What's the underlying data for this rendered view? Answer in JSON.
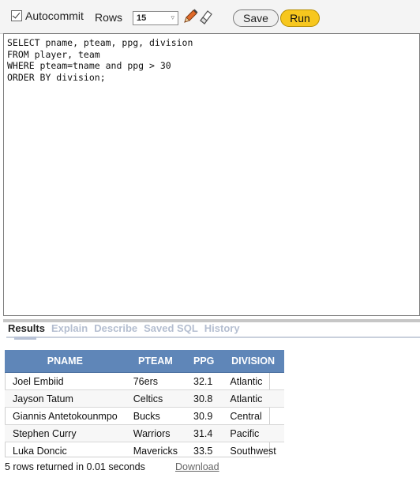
{
  "toolbar": {
    "autocommit_label": "Autocommit",
    "rows_label": "Rows",
    "rows_value": "15",
    "save_label": "Save",
    "run_label": "Run"
  },
  "editor": {
    "sql": "SELECT pname, pteam, ppg, division\nFROM player, team\nWHERE pteam=tname and ppg > 30\nORDER BY division;"
  },
  "tabs": [
    {
      "label": "Results",
      "active": true
    },
    {
      "label": "Explain"
    },
    {
      "label": "Describe"
    },
    {
      "label": "Saved SQL"
    },
    {
      "label": "History"
    }
  ],
  "results": {
    "columns": [
      "PNAME",
      "PTEAM",
      "PPG",
      "DIVISION"
    ],
    "rows": [
      [
        "Joel Embiid",
        "76ers",
        "32.1",
        "Atlantic"
      ],
      [
        "Jayson Tatum",
        "Celtics",
        "30.8",
        "Atlantic"
      ],
      [
        "Giannis Antetokounmpo",
        "Bucks",
        "30.9",
        "Central"
      ],
      [
        "Stephen Curry",
        "Warriors",
        "31.4",
        "Pacific"
      ],
      [
        "Luka Doncic",
        "Mavericks",
        "33.5",
        "Southwest"
      ]
    ]
  },
  "status": {
    "message": "5 rows returned in 0.01 seconds",
    "download_label": "Download"
  },
  "colors": {
    "header_bg": "#5f86b8",
    "run_button": "#f7c71e"
  }
}
